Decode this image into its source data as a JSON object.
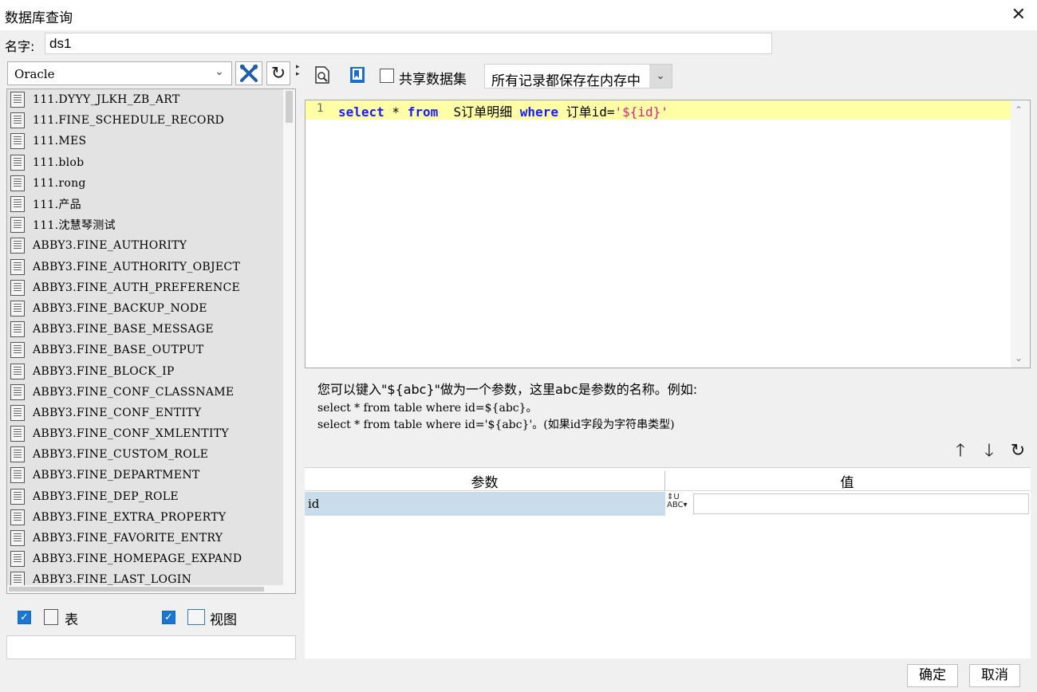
{
  "window": {
    "title": "数据库查询"
  },
  "name_field": {
    "label": "名字:",
    "value": "ds1"
  },
  "connection": {
    "selected": "Oracle"
  },
  "tables": [
    "111.DYYY_JLKH_ZB_ART",
    "111.FINE_SCHEDULE_RECORD",
    "111.MES",
    "111.blob",
    "111.rong",
    "111.产品",
    "111.沈慧琴测试",
    "ABBY3.FINE_AUTHORITY",
    "ABBY3.FINE_AUTHORITY_OBJECT",
    "ABBY3.FINE_AUTH_PREFERENCE",
    "ABBY3.FINE_BACKUP_NODE",
    "ABBY3.FINE_BASE_MESSAGE",
    "ABBY3.FINE_BASE_OUTPUT",
    "ABBY3.FINE_BLOCK_IP",
    "ABBY3.FINE_CONF_CLASSNAME",
    "ABBY3.FINE_CONF_ENTITY",
    "ABBY3.FINE_CONF_XMLENTITY",
    "ABBY3.FINE_CUSTOM_ROLE",
    "ABBY3.FINE_DEPARTMENT",
    "ABBY3.FINE_DEP_ROLE",
    "ABBY3.FINE_EXTRA_PROPERTY",
    "ABBY3.FINE_FAVORITE_ENTRY",
    "ABBY3.FINE_HOMEPAGE_EXPAND",
    "ABBY3.FINE_LAST_LOGIN"
  ],
  "filters": {
    "table_label": "表",
    "view_label": "视图",
    "table_checked": true,
    "view_checked": true
  },
  "toolbar": {
    "share_label": "共享数据集",
    "memory_mode": "所有记录都保存在内存中"
  },
  "editor": {
    "line_number": "1",
    "sql": {
      "kw_select": "select",
      "star": " * ",
      "kw_from": "from",
      "table": "  S订单明细 ",
      "kw_where": "where",
      "cond": " 订单id=",
      "str": "'${id}'"
    }
  },
  "hint": {
    "line1": "您可以键入\"${abc}\"做为一个参数，这里abc是参数的名称。例如:",
    "line2": "select * from table where id=${abc}。",
    "line3": "select * from table where id='${abc}'。(如果id字段为字符串类型)"
  },
  "params": {
    "col_name": "参数",
    "col_value": "值",
    "rows": [
      {
        "name": "id",
        "value": ""
      }
    ]
  },
  "footer": {
    "ok": "确定",
    "cancel": "取消"
  }
}
